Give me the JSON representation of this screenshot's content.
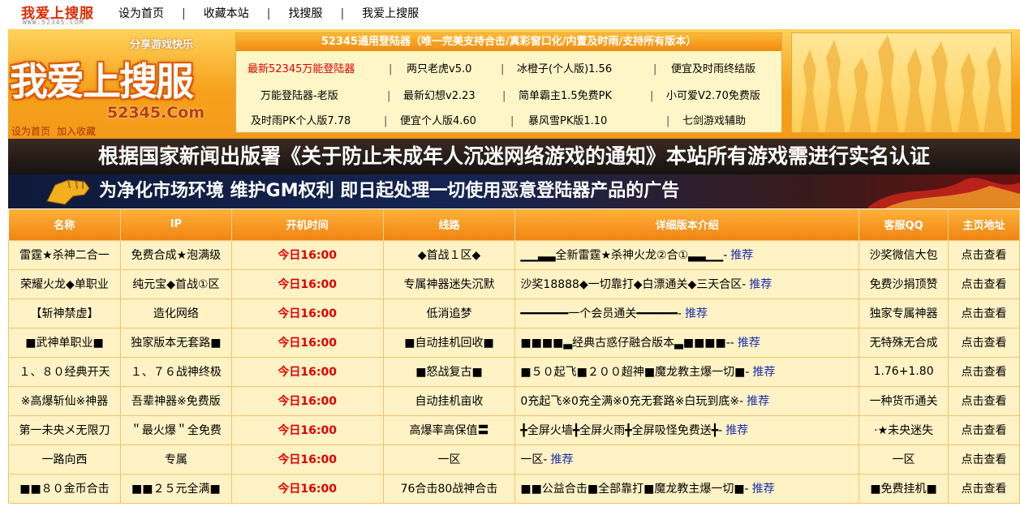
{
  "topnav": {
    "logo_text": "我爱上搜服",
    "logo_sub": "WWW.52345.COM",
    "links": [
      "设为首页",
      "收藏本站",
      "找搜服",
      "我爱上搜服"
    ],
    "separator": "|"
  },
  "header": {
    "slogan": "分享游戏快乐",
    "logo_name": "我爱上搜服",
    "domain": "52345.Com",
    "mini_links": [
      "设为首页",
      "加入收藏"
    ]
  },
  "launcher": {
    "title": "52345通用登陆器（唯一完美支持合击/真彩窗口化/内置及时雨/支持所有版本）",
    "rows": [
      [
        "最新52345万能登陆器",
        "两只老虎v5.0",
        "冰橙子(个人版)1.56",
        "便宜及时雨终结版"
      ],
      [
        "万能登陆器-老版",
        "最新幻想v2.23",
        "简单霸主1.5免费PK",
        "小可爱V2.70免费版"
      ],
      [
        "及时雨PK个人版7.78",
        "便宜个人版4.60",
        "暴风雪PK版1.10",
        "七剑游戏辅助"
      ]
    ],
    "separator": "|",
    "highlight_color": "#e00000"
  },
  "notices": {
    "line1": "根据国家新闻出版署《关于防止未成年人沉迷网络游戏的通知》本站所有游戏需进行实名认证",
    "line2": "为净化市场环境  维护GM权利  即日起处理一切使用恶意登陆器产品的广告"
  },
  "table": {
    "columns": [
      "名称",
      "IP",
      "开机时间",
      "线路",
      "详细版本介绍",
      "客服QQ",
      "主页地址"
    ],
    "recommend_label": "推荐",
    "rows": [
      {
        "name": "雷霆★杀神二合一",
        "ip": "免费合成★泡满级",
        "time": "今日16:00",
        "line": "◆首战１区◆",
        "detail": "▁▁▃▃全新雷霆★杀神火龙②合①▃▃▁▁-",
        "qq": "沙奖微信大包",
        "home": "点击查看"
      },
      {
        "name": "荣耀火龙◆单职业",
        "ip": "纯元宝◆首战①区",
        "time": "今日16:00",
        "line": "专属神器迷失沉默",
        "detail": "沙奖18888◆一切靠打◆白漂通关◆三天合区-",
        "qq": "免费沙捐顶赞",
        "home": "点击查看"
      },
      {
        "name": "【斩神禁虚】",
        "ip": "造化网络",
        "time": "今日16:00",
        "line": "低消追梦",
        "detail": "━━━━━━━一个会员通关━━━━━━-",
        "qq": "独家专属神器",
        "home": "点击查看"
      },
      {
        "name": "■武神单职业■",
        "ip": "独家版本无套路■",
        "time": "今日16:00",
        "line": "■自动挂机回收■",
        "detail": "■■■■▃经典古惑仔融合版本▃■■■■--",
        "qq": "无特殊无合成",
        "home": "点击查看"
      },
      {
        "name": "１、８０经典开天",
        "ip": "１、７６战神终极",
        "time": "今日16:00",
        "line": "■怒战复古■",
        "detail": "■５０起飞■２００超神■魔龙教主爆一切■-",
        "qq": "1.76+1.80",
        "home": "点击查看"
      },
      {
        "name": "※高爆斩仙※神器",
        "ip": "吾辈神器※免费版",
        "time": "今日16:00",
        "line": "自动挂机亩收",
        "detail": "0充起飞※0充全满※0充无套路※白玩到底※-",
        "qq": "一种货币通关",
        "home": "点击查看"
      },
      {
        "name": "第一未央メ无限刀",
        "ip": "＂最火爆＂全免费",
        "time": "今日16:00",
        "line": "高爆率高保值〓",
        "detail": "╋全屏火墙╋全屏火雨╋全屏吸怪免费送╋-",
        "qq": "·★未央迷失",
        "home": "点击查看"
      },
      {
        "name": "一路向西",
        "ip": "专属",
        "time": "今日16:00",
        "line": "一区",
        "detail": "一区-",
        "qq": "一区",
        "home": "点击查看"
      },
      {
        "name": "■■８０金币合击",
        "ip": "■■２５元全满■",
        "time": "今日16:00",
        "line": "76合击80战神合击",
        "detail": "■■公益合击■全部靠打■魔龙教主爆一切■-",
        "qq": "■免费挂机■",
        "home": "点击查看"
      }
    ]
  },
  "colors": {
    "header_orange": "#f39a1a",
    "time_red": "#e00000",
    "recommend_blue": "#1a2fb0",
    "row_bg": "#fff2c5"
  }
}
